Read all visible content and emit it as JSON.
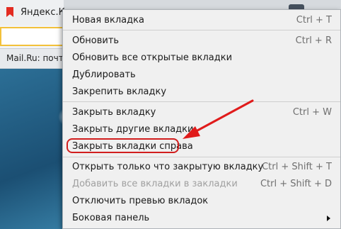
{
  "tabbar": {
    "active_tab_title": "Яндекс.Ко"
  },
  "bookmarks": {
    "item": "Mail.Ru: почт"
  },
  "menu": {
    "items": [
      {
        "label": "Новая вкладка",
        "shortcut": "Ctrl + T"
      },
      {
        "label": "Обновить",
        "shortcut": "Ctrl + R"
      },
      {
        "label": "Обновить все открытые вкладки",
        "shortcut": ""
      },
      {
        "label": "Дублировать",
        "shortcut": ""
      },
      {
        "label": "Закрепить вкладку",
        "shortcut": ""
      },
      {
        "label": "Закрыть вкладку",
        "shortcut": "Ctrl + W"
      },
      {
        "label": "Закрыть другие вкладки",
        "shortcut": ""
      },
      {
        "label": "Закрыть вкладки справа",
        "shortcut": ""
      },
      {
        "label": "Открыть только что закрытую вкладку",
        "shortcut": "Ctrl + Shift + T"
      },
      {
        "label": "Добавить все вкладки в закладки",
        "shortcut": "Ctrl + Shift + D",
        "disabled": true
      },
      {
        "label": "Отключить превью вкладок",
        "shortcut": ""
      },
      {
        "label": "Боковая панель",
        "shortcut": "",
        "submenu": true
      }
    ]
  },
  "annotation": {
    "highlight_color": "#d11e1e",
    "highlighted_item": "Закрыть вкладки справа"
  }
}
